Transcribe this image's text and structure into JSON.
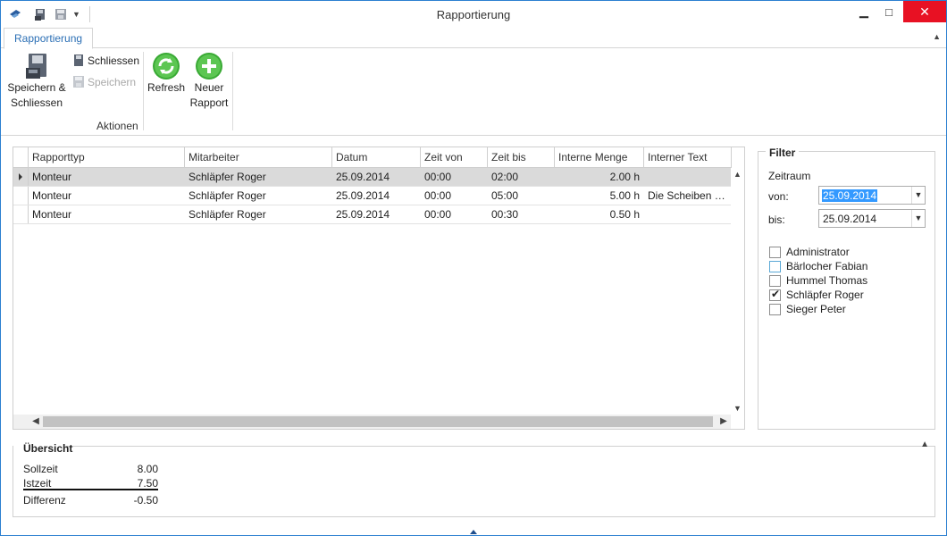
{
  "window": {
    "title": "Rapportierung",
    "controls": {
      "minimize": "▁",
      "maximize": "□",
      "close": "✕"
    }
  },
  "ribbon": {
    "tabs": [
      {
        "label": "Rapportierung",
        "active": true
      }
    ],
    "actions": {
      "save_close_line1": "Speichern &",
      "save_close_line2": "Schliessen",
      "close": "Schliessen",
      "save": "Speichern",
      "group_label": "Aktionen"
    },
    "refresh": "Refresh",
    "new_report_line1": "Neuer",
    "new_report_line2": "Rapport"
  },
  "grid": {
    "columns": [
      "Rapporttyp",
      "Mitarbeiter",
      "Datum",
      "Zeit von",
      "Zeit bis",
      "Interne Menge",
      "Interner Text"
    ],
    "rows": [
      {
        "typ": "Monteur",
        "mitarbeiter": "Schläpfer Roger",
        "datum": "25.09.2014",
        "von": "00:00",
        "bis": "02:00",
        "menge": "2.00 h",
        "text": ""
      },
      {
        "typ": "Monteur",
        "mitarbeiter": "Schläpfer Roger",
        "datum": "25.09.2014",
        "von": "00:00",
        "bis": "05:00",
        "menge": "5.00 h",
        "text": "Die Scheiben w..."
      },
      {
        "typ": "Monteur",
        "mitarbeiter": "Schläpfer Roger",
        "datum": "25.09.2014",
        "von": "00:00",
        "bis": "00:30",
        "menge": "0.50 h",
        "text": ""
      }
    ]
  },
  "filter": {
    "title": "Filter",
    "zeitraum": "Zeitraum",
    "von_label": "von:",
    "von_value": "25.09.2014",
    "bis_label": "bis:",
    "bis_value": "25.09.2014",
    "employees": [
      {
        "name": "Administrator",
        "checked": false
      },
      {
        "name": "Bärlocher Fabian",
        "checked": false
      },
      {
        "name": "Hummel Thomas",
        "checked": false
      },
      {
        "name": "Schläpfer Roger",
        "checked": true
      },
      {
        "name": "Sieger Peter",
        "checked": false
      }
    ]
  },
  "overview": {
    "title": "Übersicht",
    "sollzeit_label": "Sollzeit",
    "sollzeit_value": "8.00",
    "istzeit_label": "Istzeit",
    "istzeit_value": "7.50",
    "differenz_label": "Differenz",
    "differenz_value": "-0.50"
  },
  "colors": {
    "accent": "#2b7fd0",
    "close_button": "#e81123",
    "selected_row": "#dadada"
  }
}
